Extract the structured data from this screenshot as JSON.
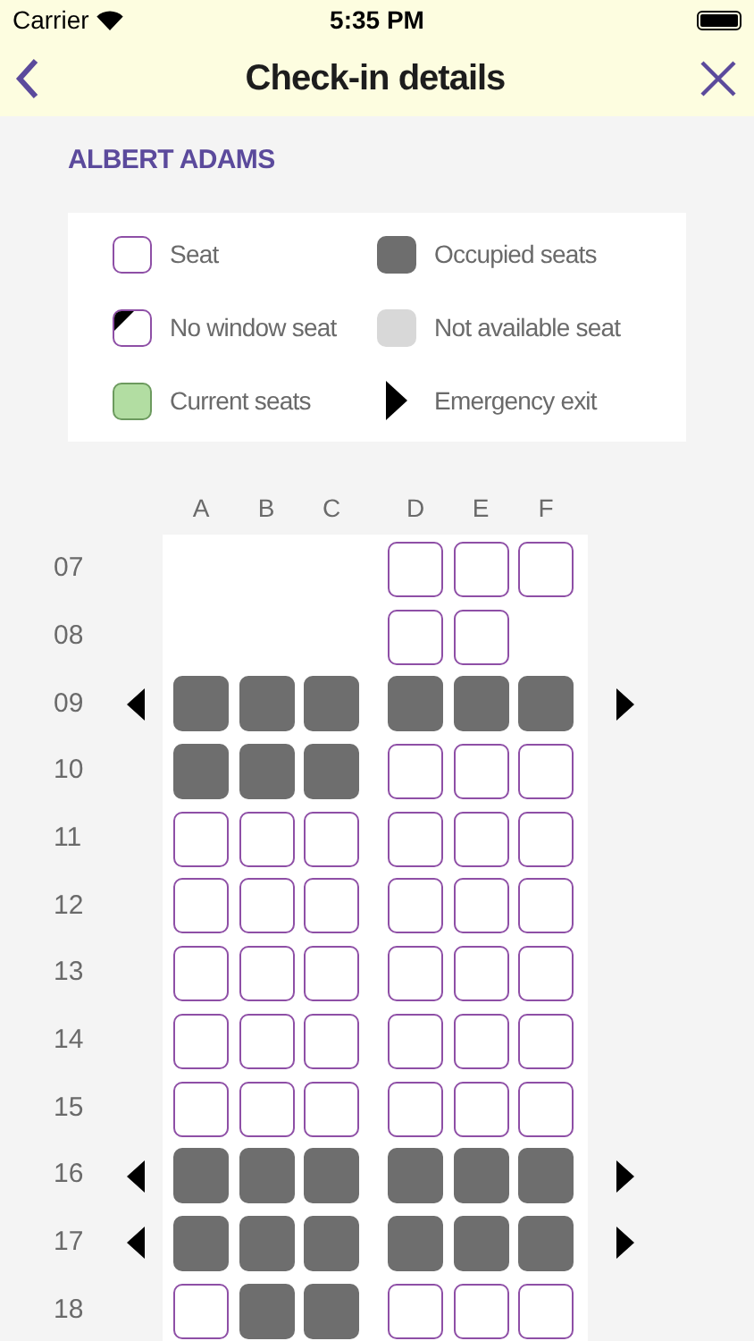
{
  "status_bar": {
    "carrier": "Carrier",
    "time": "5:35 PM"
  },
  "header": {
    "title": "Check-in details"
  },
  "passenger": "ALBERT ADAMS",
  "legend": [
    {
      "kind": "free",
      "label": "Seat"
    },
    {
      "kind": "occupied",
      "label": "Occupied seats"
    },
    {
      "kind": "no_window",
      "label": "No window seat"
    },
    {
      "kind": "unavailable",
      "label": "Not available seat"
    },
    {
      "kind": "current",
      "label": "Current seats"
    },
    {
      "kind": "exit",
      "label": "Emergency exit"
    }
  ],
  "columns": [
    "A",
    "B",
    "C",
    "D",
    "E",
    "F"
  ],
  "rows": [
    {
      "label": "07",
      "exit": false,
      "seats": [
        {
          "kind": "empty"
        },
        {
          "kind": "empty"
        },
        {
          "kind": "empty"
        },
        {
          "kind": "free"
        },
        {
          "kind": "free"
        },
        {
          "kind": "free"
        }
      ]
    },
    {
      "label": "08",
      "exit": false,
      "seats": [
        {
          "kind": "empty"
        },
        {
          "kind": "empty"
        },
        {
          "kind": "empty"
        },
        {
          "kind": "free"
        },
        {
          "kind": "free"
        },
        {
          "kind": "empty"
        }
      ]
    },
    {
      "label": "09",
      "exit": true,
      "seats": [
        {
          "kind": "occupied"
        },
        {
          "kind": "occupied"
        },
        {
          "kind": "occupied"
        },
        {
          "kind": "occupied"
        },
        {
          "kind": "occupied"
        },
        {
          "kind": "occupied"
        }
      ]
    },
    {
      "label": "10",
      "exit": false,
      "seats": [
        {
          "kind": "occupied"
        },
        {
          "kind": "occupied"
        },
        {
          "kind": "occupied"
        },
        {
          "kind": "free"
        },
        {
          "kind": "free"
        },
        {
          "kind": "free"
        }
      ]
    },
    {
      "label": "11",
      "exit": false,
      "seats": [
        {
          "kind": "free"
        },
        {
          "kind": "free"
        },
        {
          "kind": "free"
        },
        {
          "kind": "free"
        },
        {
          "kind": "free"
        },
        {
          "kind": "free"
        }
      ]
    },
    {
      "label": "12",
      "exit": false,
      "seats": [
        {
          "kind": "free"
        },
        {
          "kind": "free"
        },
        {
          "kind": "free"
        },
        {
          "kind": "free"
        },
        {
          "kind": "free"
        },
        {
          "kind": "free"
        }
      ]
    },
    {
      "label": "13",
      "exit": false,
      "seats": [
        {
          "kind": "free"
        },
        {
          "kind": "free"
        },
        {
          "kind": "free"
        },
        {
          "kind": "free"
        },
        {
          "kind": "free"
        },
        {
          "kind": "free"
        }
      ]
    },
    {
      "label": "14",
      "exit": false,
      "seats": [
        {
          "kind": "free"
        },
        {
          "kind": "free"
        },
        {
          "kind": "free"
        },
        {
          "kind": "free"
        },
        {
          "kind": "free"
        },
        {
          "kind": "free"
        }
      ]
    },
    {
      "label": "15",
      "exit": false,
      "seats": [
        {
          "kind": "free"
        },
        {
          "kind": "free"
        },
        {
          "kind": "free"
        },
        {
          "kind": "free"
        },
        {
          "kind": "free"
        },
        {
          "kind": "free"
        }
      ]
    },
    {
      "label": "16",
      "exit": true,
      "seats": [
        {
          "kind": "occupied"
        },
        {
          "kind": "occupied"
        },
        {
          "kind": "occupied"
        },
        {
          "kind": "occupied"
        },
        {
          "kind": "occupied"
        },
        {
          "kind": "occupied"
        }
      ]
    },
    {
      "label": "17",
      "exit": true,
      "seats": [
        {
          "kind": "occupied"
        },
        {
          "kind": "occupied"
        },
        {
          "kind": "occupied"
        },
        {
          "kind": "occupied"
        },
        {
          "kind": "occupied"
        },
        {
          "kind": "occupied"
        }
      ]
    },
    {
      "label": "18",
      "exit": false,
      "seats": [
        {
          "kind": "free"
        },
        {
          "kind": "occupied"
        },
        {
          "kind": "occupied"
        },
        {
          "kind": "free"
        },
        {
          "kind": "free"
        },
        {
          "kind": "free"
        }
      ]
    }
  ]
}
